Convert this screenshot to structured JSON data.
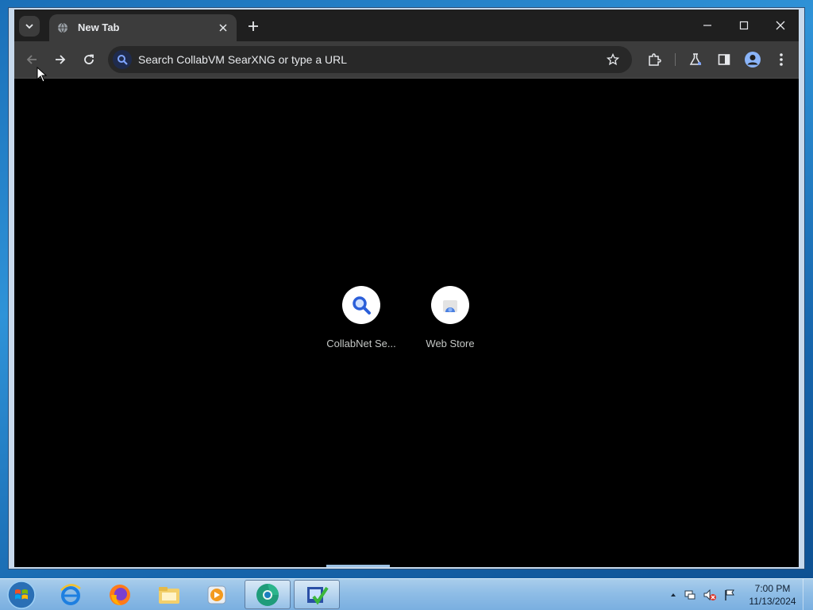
{
  "browser": {
    "tab": {
      "title": "New Tab"
    },
    "omnibox": {
      "placeholder": "Search CollabVM SearXNG or type a URL"
    },
    "shortcuts": [
      {
        "label": "CollabNet Se...",
        "icon": "search-magnifier-icon"
      },
      {
        "label": "Web Store",
        "icon": "webstore-icon"
      }
    ]
  },
  "taskbar": {
    "clock": {
      "time": "7:00 PM",
      "date": "11/13/2024"
    },
    "apps": [
      "internet-explorer-icon",
      "firefox-icon",
      "file-explorer-icon",
      "media-player-icon",
      "chrome-icon",
      "task-app-icon"
    ]
  },
  "colors": {
    "accent": "#3b6fd6",
    "toolbar": "#3c3c3c",
    "tabstrip": "#1f1f1f",
    "page": "#000000"
  }
}
